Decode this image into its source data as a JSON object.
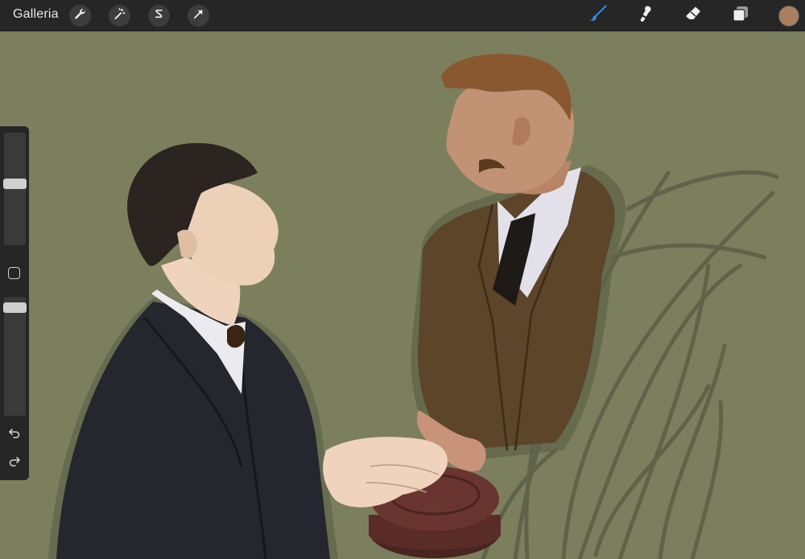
{
  "toolbar": {
    "gallery_label": "Galleria",
    "left_tools": [
      {
        "name": "actions",
        "icon": "wrench-icon"
      },
      {
        "name": "adjustments",
        "icon": "magic-wand-icon"
      },
      {
        "name": "selection",
        "icon": "selection-s-icon"
      },
      {
        "name": "transform",
        "icon": "arrow-cursor-icon"
      }
    ],
    "right_tools": [
      {
        "name": "brush",
        "icon": "brush-icon",
        "active": true
      },
      {
        "name": "smudge",
        "icon": "smudge-icon",
        "active": false
      },
      {
        "name": "eraser",
        "icon": "eraser-icon",
        "active": false
      },
      {
        "name": "layers",
        "icon": "layers-icon",
        "active": false
      }
    ],
    "current_color": "#a9805f",
    "active_tool_color": "#2d8cf0"
  },
  "sidebar": {
    "brush_size_level": 0.55,
    "opacity_level": 0.95,
    "icons": [
      "modify-square-icon",
      "undo-icon",
      "redo-icon"
    ]
  },
  "canvas": {
    "background_color": "#7b7f5d",
    "figures": [
      "man-in-black-suit",
      "man-in-brown-coat",
      "round-box"
    ]
  }
}
